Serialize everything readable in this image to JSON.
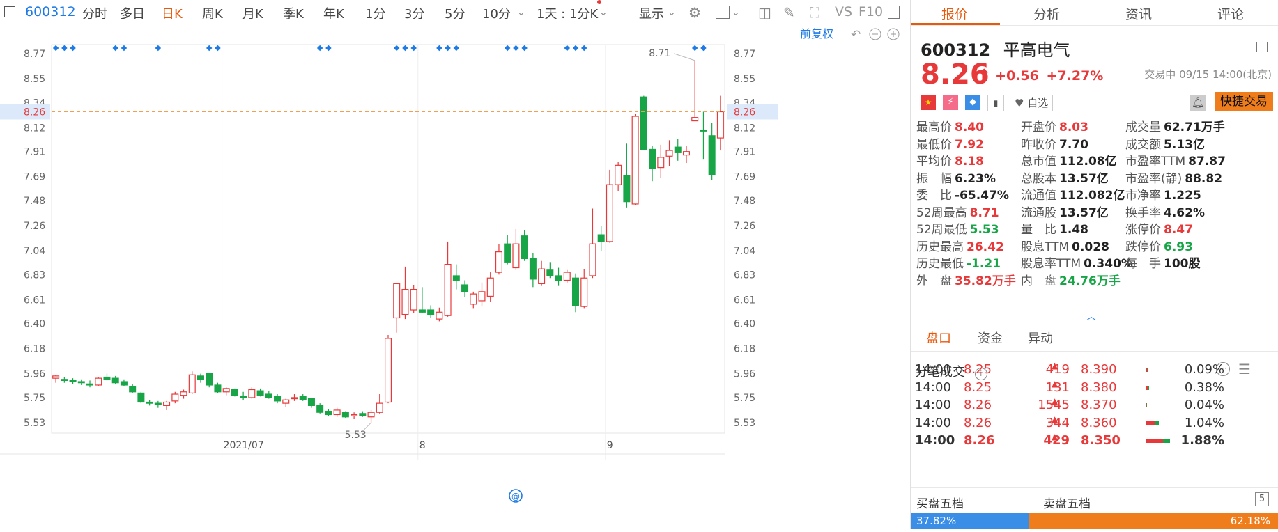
{
  "toolbar": {
    "code": "600312",
    "periods": [
      "分时",
      "多日",
      "日K",
      "周K",
      "月K",
      "季K",
      "年K",
      "1分",
      "3分",
      "5分",
      "10分"
    ],
    "active": "日K",
    "interval": "1天 : 1分K",
    "display": "显示",
    "vs": "VS",
    "f10": "F10"
  },
  "chart": {
    "adjust": "前复权",
    "y_ticks": [
      "8.77",
      "8.55",
      "8.34",
      "8.12",
      "7.91",
      "7.69",
      "7.48",
      "7.26",
      "7.04",
      "6.83",
      "6.61",
      "6.40",
      "6.18",
      "5.96",
      "5.75",
      "5.53"
    ],
    "current_price_label": "8.26",
    "x_labels": [
      "2021/07",
      "8",
      "9"
    ],
    "high_label": "8.71",
    "low_label": "5.53"
  },
  "chart_data": {
    "type": "candlestick",
    "x": [
      "2021/07",
      "8",
      "9"
    ],
    "ylim": [
      5.45,
      8.85
    ],
    "current": 8.26,
    "high_marker": 8.71,
    "low_marker": 5.53,
    "colors": {
      "up": "#e8393a",
      "down": "#18a547"
    },
    "candles": [
      [
        5.92,
        5.95,
        5.88,
        5.94
      ],
      [
        5.91,
        5.93,
        5.88,
        5.9
      ],
      [
        5.9,
        5.92,
        5.87,
        5.89
      ],
      [
        5.89,
        5.91,
        5.86,
        5.88
      ],
      [
        5.87,
        5.9,
        5.84,
        5.86
      ],
      [
        5.86,
        5.93,
        5.85,
        5.92
      ],
      [
        5.93,
        5.96,
        5.9,
        5.91
      ],
      [
        5.92,
        5.94,
        5.87,
        5.88
      ],
      [
        5.89,
        5.91,
        5.85,
        5.86
      ],
      [
        5.85,
        5.87,
        5.79,
        5.8
      ],
      [
        5.79,
        5.8,
        5.7,
        5.71
      ],
      [
        5.71,
        5.73,
        5.68,
        5.7
      ],
      [
        5.7,
        5.72,
        5.66,
        5.69
      ],
      [
        5.68,
        5.72,
        5.64,
        5.71
      ],
      [
        5.72,
        5.8,
        5.7,
        5.78
      ],
      [
        5.77,
        5.82,
        5.74,
        5.8
      ],
      [
        5.79,
        5.98,
        5.78,
        5.95
      ],
      [
        5.94,
        5.96,
        5.88,
        5.91
      ],
      [
        5.96,
        5.97,
        5.84,
        5.86
      ],
      [
        5.86,
        5.88,
        5.79,
        5.8
      ],
      [
        5.8,
        5.84,
        5.77,
        5.83
      ],
      [
        5.82,
        5.83,
        5.76,
        5.77
      ],
      [
        5.76,
        5.8,
        5.73,
        5.75
      ],
      [
        5.75,
        5.84,
        5.74,
        5.82
      ],
      [
        5.81,
        5.83,
        5.76,
        5.77
      ],
      [
        5.78,
        5.81,
        5.74,
        5.75
      ],
      [
        5.76,
        5.78,
        5.7,
        5.72
      ],
      [
        5.7,
        5.74,
        5.67,
        5.73
      ],
      [
        5.74,
        5.78,
        5.72,
        5.75
      ],
      [
        5.76,
        5.78,
        5.72,
        5.73
      ],
      [
        5.74,
        5.75,
        5.66,
        5.68
      ],
      [
        5.68,
        5.7,
        5.61,
        5.62
      ],
      [
        5.63,
        5.65,
        5.59,
        5.6
      ],
      [
        5.6,
        5.66,
        5.58,
        5.64
      ],
      [
        5.62,
        5.63,
        5.57,
        5.58
      ],
      [
        5.59,
        5.62,
        5.56,
        5.6
      ],
      [
        5.61,
        5.63,
        5.58,
        5.59
      ],
      [
        5.58,
        5.64,
        5.53,
        5.62
      ],
      [
        5.62,
        5.78,
        5.61,
        5.7
      ],
      [
        5.71,
        6.3,
        5.7,
        6.27
      ],
      [
        6.45,
        6.75,
        6.32,
        6.75
      ],
      [
        6.48,
        6.9,
        6.44,
        6.7
      ],
      [
        6.52,
        6.74,
        6.49,
        6.7
      ],
      [
        6.52,
        6.72,
        6.49,
        6.5
      ],
      [
        6.52,
        6.56,
        6.45,
        6.48
      ],
      [
        6.44,
        6.54,
        6.42,
        6.5
      ],
      [
        6.47,
        7.12,
        6.46,
        6.92
      ],
      [
        6.82,
        6.92,
        6.7,
        6.78
      ],
      [
        6.74,
        6.78,
        6.63,
        6.68
      ],
      [
        6.57,
        6.68,
        6.53,
        6.66
      ],
      [
        6.6,
        6.76,
        6.55,
        6.68
      ],
      [
        6.64,
        6.85,
        6.59,
        6.8
      ],
      [
        6.85,
        7.1,
        6.83,
        7.03
      ],
      [
        7.1,
        7.18,
        6.92,
        6.94
      ],
      [
        6.89,
        7.23,
        6.87,
        7.1
      ],
      [
        7.17,
        7.22,
        6.95,
        6.97
      ],
      [
        6.97,
        7.02,
        6.72,
        6.79
      ],
      [
        6.75,
        6.95,
        6.73,
        6.88
      ],
      [
        6.87,
        6.94,
        6.8,
        6.82
      ],
      [
        6.82,
        6.89,
        6.73,
        6.78
      ],
      [
        6.78,
        6.87,
        6.76,
        6.85
      ],
      [
        6.8,
        6.84,
        6.5,
        6.56
      ],
      [
        6.55,
        6.88,
        6.53,
        6.8
      ],
      [
        6.82,
        7.41,
        6.8,
        7.1
      ],
      [
        7.18,
        7.26,
        7.04,
        7.12
      ],
      [
        7.12,
        7.75,
        7.11,
        7.62
      ],
      [
        7.62,
        7.82,
        7.56,
        7.79
      ],
      [
        7.7,
        7.98,
        7.42,
        7.47
      ],
      [
        7.45,
        8.24,
        7.44,
        8.22
      ],
      [
        8.39,
        8.4,
        7.93,
        7.93
      ],
      [
        7.93,
        7.96,
        7.65,
        7.76
      ],
      [
        7.77,
        7.97,
        7.68,
        7.86
      ],
      [
        7.87,
        8.01,
        7.78,
        7.92
      ],
      [
        7.95,
        8.02,
        7.83,
        7.9
      ],
      [
        7.88,
        7.96,
        7.81,
        7.91
      ],
      [
        8.18,
        8.71,
        8.18,
        8.21
      ],
      [
        8.1,
        8.26,
        7.84,
        8.09
      ],
      [
        8.05,
        8.16,
        7.66,
        7.71
      ],
      [
        8.03,
        8.4,
        7.92,
        8.26
      ]
    ]
  },
  "quote": {
    "tabs": [
      "报价",
      "分析",
      "资讯",
      "评论"
    ],
    "active_tab": "报价",
    "code": "600312",
    "name": "平高电气",
    "price": "8.26",
    "arrow": "⬆",
    "change": "+0.56",
    "change_pct": "+7.27%",
    "trade_status": "交易中 09/15 14:00(北京)",
    "watch_label": "自选",
    "fast_trade": "快捷交易",
    "stats": [
      [
        {
          "k": "最高价",
          "v": "8.40",
          "c": "red"
        },
        {
          "k": "开盘价",
          "v": "8.03",
          "c": "red"
        },
        {
          "k": "成交量",
          "v": "62.71万手",
          "c": "dark"
        }
      ],
      [
        {
          "k": "最低价",
          "v": "7.92",
          "c": "red"
        },
        {
          "k": "昨收价",
          "v": "7.70",
          "c": "dark"
        },
        {
          "k": "成交额",
          "v": "5.13亿",
          "c": "dark"
        }
      ],
      [
        {
          "k": "平均价",
          "v": "8.18",
          "c": "red"
        },
        {
          "k": "总市值",
          "v": "112.08亿",
          "c": "dark"
        },
        {
          "k": "市盈率TTM",
          "v": "87.87",
          "c": "dark"
        }
      ],
      [
        {
          "k": "振　幅",
          "v": "6.23%",
          "c": "dark"
        },
        {
          "k": "总股本",
          "v": "13.57亿",
          "c": "dark"
        },
        {
          "k": "市盈率(静)",
          "v": "88.82",
          "c": "dark"
        }
      ],
      [
        {
          "k": "委　比",
          "v": "-65.47%",
          "c": "dark"
        },
        {
          "k": "流通值",
          "v": "112.082亿",
          "c": "dark"
        },
        {
          "k": "市净率",
          "v": "1.225",
          "c": "dark"
        }
      ],
      [
        {
          "k": "52周最高",
          "v": "8.71",
          "c": "red"
        },
        {
          "k": "流通股",
          "v": "13.57亿",
          "c": "dark"
        },
        {
          "k": "换手率",
          "v": "4.62%",
          "c": "dark"
        }
      ],
      [
        {
          "k": "52周最低",
          "v": "5.53",
          "c": "green"
        },
        {
          "k": "量　比",
          "v": "1.48",
          "c": "dark"
        },
        {
          "k": "涨停价",
          "v": "8.47",
          "c": "red"
        }
      ],
      [
        {
          "k": "历史最高",
          "v": "26.42",
          "c": "red"
        },
        {
          "k": "股息TTM",
          "v": "0.028",
          "c": "dark"
        },
        {
          "k": "跌停价",
          "v": "6.93",
          "c": "green"
        }
      ],
      [
        {
          "k": "历史最低",
          "v": "-1.21",
          "c": "green"
        },
        {
          "k": "股息率TTM",
          "v": "0.340%",
          "c": "dark"
        },
        {
          "k": "每　手",
          "v": "100股",
          "c": "dark"
        }
      ],
      [
        {
          "k": "外　盘",
          "v": "35.82万手",
          "c": "red"
        },
        {
          "k": "内　盘",
          "v": "24.76万手",
          "c": "green"
        }
      ]
    ],
    "subtabs": [
      "盘口",
      "资金",
      "异动"
    ],
    "ticks_title": "分笔成交",
    "ticks": [
      {
        "time": "14:00",
        "price": "8.25",
        "vol": "419",
        "lvl": "8.390",
        "pct": "0.09%"
      },
      {
        "time": "14:00",
        "price": "8.25",
        "vol": "131",
        "lvl": "8.380",
        "pct": "0.38%"
      },
      {
        "time": "14:00",
        "price": "8.26",
        "vol": "1545",
        "lvl": "8.370",
        "pct": "0.04%"
      },
      {
        "time": "14:00",
        "price": "8.26",
        "vol": "344",
        "lvl": "8.360",
        "pct": "1.04%"
      },
      {
        "time": "14:00",
        "price": "8.26",
        "vol": "429",
        "lvl": "8.350",
        "pct": "1.88%"
      }
    ],
    "buy5": "买盘五档",
    "sell5": "卖盘五档",
    "buy_pct": "37.82%",
    "sell_pct": "62.18%",
    "five": "5"
  }
}
